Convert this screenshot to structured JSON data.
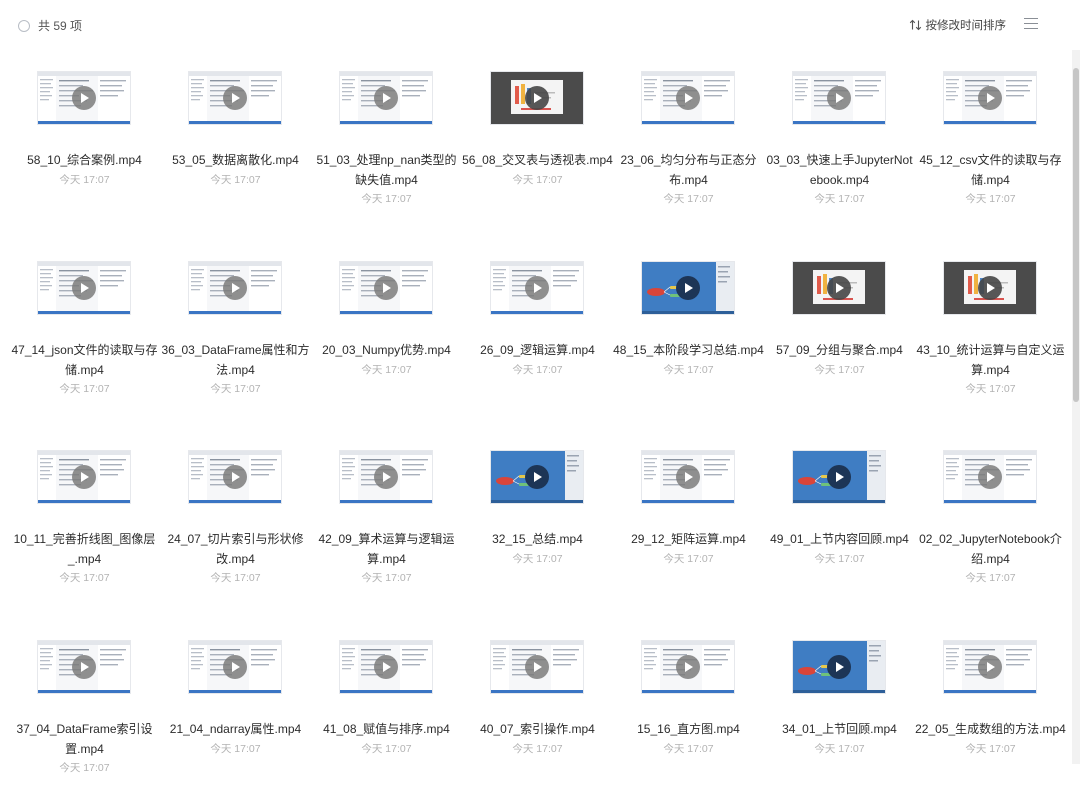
{
  "header": {
    "count_label": "共 59 项",
    "sort_label": "按修改时间排序"
  },
  "files": [
    {
      "name": "58_10_综合案例.mp4",
      "time": "今天 17:07",
      "style": "light"
    },
    {
      "name": "53_05_数据离散化.mp4",
      "time": "今天 17:07",
      "style": "light"
    },
    {
      "name": "51_03_处理np_nan类型的缺失值.mp4",
      "time": "今天 17:07",
      "style": "light"
    },
    {
      "name": "56_08_交叉表与透视表.mp4",
      "time": "今天 17:07",
      "style": "dark"
    },
    {
      "name": "23_06_均匀分布与正态分布.mp4",
      "time": "今天 17:07",
      "style": "light"
    },
    {
      "name": "03_03_快速上手JupyterNotebook.mp4",
      "time": "今天 17:07",
      "style": "light"
    },
    {
      "name": "45_12_csv文件的读取与存储.mp4",
      "time": "今天 17:07",
      "style": "light"
    },
    {
      "name": "47_14_json文件的读取与存储.mp4",
      "time": "今天 17:07",
      "style": "light"
    },
    {
      "name": "36_03_DataFrame属性和方法.mp4",
      "time": "今天 17:07",
      "style": "light"
    },
    {
      "name": "20_03_Numpy优势.mp4",
      "time": "今天 17:07",
      "style": "light"
    },
    {
      "name": "26_09_逻辑运算.mp4",
      "time": "今天 17:07",
      "style": "light"
    },
    {
      "name": "48_15_本阶段学习总结.mp4",
      "time": "今天 17:07",
      "style": "blue"
    },
    {
      "name": "57_09_分组与聚合.mp4",
      "time": "今天 17:07",
      "style": "dark"
    },
    {
      "name": "43_10_统计运算与自定义运算.mp4",
      "time": "今天 17:07",
      "style": "dark"
    },
    {
      "name": "10_11_完善折线图_图像层_.mp4",
      "time": "今天 17:07",
      "style": "light"
    },
    {
      "name": "24_07_切片索引与形状修改.mp4",
      "time": "今天 17:07",
      "style": "light"
    },
    {
      "name": "42_09_算术运算与逻辑运算.mp4",
      "time": "今天 17:07",
      "style": "light"
    },
    {
      "name": "32_15_总结.mp4",
      "time": "今天 17:07",
      "style": "blue"
    },
    {
      "name": "29_12_矩阵运算.mp4",
      "time": "今天 17:07",
      "style": "light"
    },
    {
      "name": "49_01_上节内容回顾.mp4",
      "time": "今天 17:07",
      "style": "blue"
    },
    {
      "name": "02_02_JupyterNotebook介绍.mp4",
      "time": "今天 17:07",
      "style": "light"
    },
    {
      "name": "37_04_DataFrame索引设置.mp4",
      "time": "今天 17:07",
      "style": "light"
    },
    {
      "name": "21_04_ndarray属性.mp4",
      "time": "今天 17:07",
      "style": "light"
    },
    {
      "name": "41_08_赋值与排序.mp4",
      "time": "今天 17:07",
      "style": "light"
    },
    {
      "name": "40_07_索引操作.mp4",
      "time": "今天 17:07",
      "style": "light"
    },
    {
      "name": "15_16_直方图.mp4",
      "time": "今天 17:07",
      "style": "light"
    },
    {
      "name": "34_01_上节回顾.mp4",
      "time": "今天 17:07",
      "style": "blue"
    },
    {
      "name": "22_05_生成数组的方法.mp4",
      "time": "今天 17:07",
      "style": "light"
    }
  ]
}
